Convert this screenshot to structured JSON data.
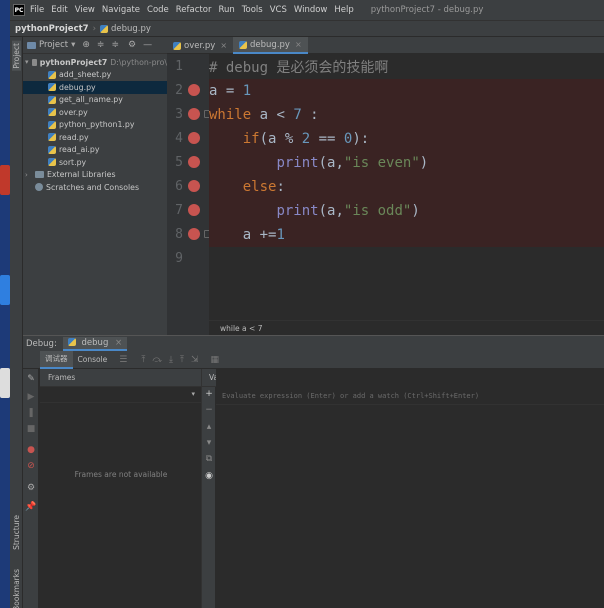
{
  "window": {
    "logo": "PC",
    "menu": [
      "File",
      "Edit",
      "View",
      "Navigate",
      "Code",
      "Refactor",
      "Run",
      "Tools",
      "VCS",
      "Window",
      "Help"
    ],
    "title": "pythonProject7 - debug.py"
  },
  "breadcrumb": {
    "project": "pythonProject7",
    "file": "debug.py"
  },
  "left_stripe": {
    "project": "Project",
    "structure": "Structure",
    "bookmarks": "Bookmarks"
  },
  "project_panel": {
    "header": "Project",
    "root": {
      "name": "pythonProject7",
      "path": "D:\\python-pro\\"
    },
    "files": [
      "add_sheet.py",
      "debug.py",
      "get_all_name.py",
      "over.py",
      "python_python1.py",
      "read.py",
      "read_ai.py",
      "sort.py"
    ],
    "selected": "debug.py",
    "external": "External Libraries",
    "scratches": "Scratches and Consoles"
  },
  "editor": {
    "tabs": [
      {
        "label": "over.py",
        "active": false
      },
      {
        "label": "debug.py",
        "active": true
      }
    ],
    "line_numbers": [
      "1",
      "2",
      "3",
      "4",
      "5",
      "6",
      "7",
      "8",
      "9"
    ],
    "lines": [
      "# debug 是必须会的技能啊",
      "a = 1",
      "while a < 7 :",
      "    if(a % 2 == 0):",
      "        print(a,\"is even\")",
      "    else:",
      "        print(a,\"is odd\")",
      "    a +=1",
      ""
    ],
    "breakpoint_lines": [
      2,
      3,
      4,
      5,
      6,
      7,
      8
    ],
    "footer_context": "while a < 7"
  },
  "debug": {
    "label": "Debug:",
    "session": "debug",
    "tabs": [
      "调试器",
      "Console"
    ],
    "frames_header": "Frames",
    "frames_empty": "Frames are not available",
    "variables_header": "Variables",
    "eval_placeholder": "Evaluate expression (Enter) or add a watch (Ctrl+Shift+Enter)"
  },
  "colors": {
    "breakpoint": "#c75450",
    "selection": "#0d293e",
    "keyword": "#cc7832",
    "number": "#6897bb",
    "string": "#6a8759",
    "comment": "#808080"
  }
}
